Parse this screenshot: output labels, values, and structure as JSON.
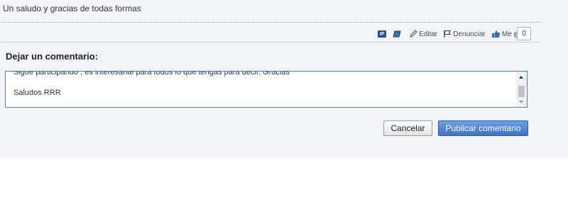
{
  "message": {
    "text": "Un saludo y gracias de todas formas"
  },
  "toolbar": {
    "ip_label": "IP",
    "edit_label": "Editar",
    "report_label": "Denunciar",
    "like_label": "Me gusta",
    "like_count": "0"
  },
  "comment": {
    "title": "Dejar un comentario:",
    "line1": "Sigue participando , es interesante para todos lo que tengas para decir. Gracias",
    "line2": "Saludos RRR"
  },
  "buttons": {
    "cancel": "Cancelar",
    "publish": "Publicar comentario"
  },
  "colors": {
    "panel_bg": "#f1f5fa",
    "publish_button": "#4a80cf",
    "textarea_border": "#5a7fa6"
  }
}
